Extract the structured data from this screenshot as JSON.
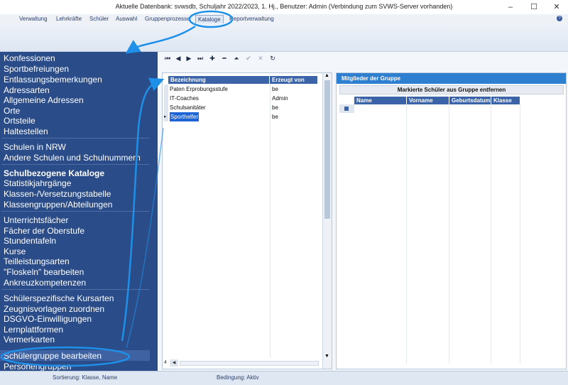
{
  "window": {
    "title": "Aktuelle Datenbank: svwsdb, Schuljahr 2022/2023, 1. Hj., Benutzer: Admin (Verbindung zum SVWS-Server vorhanden)",
    "minimize": "–",
    "maximize": "☐",
    "close": "✕"
  },
  "menu": {
    "items": [
      "Verwaltung",
      "Lehrkräfte",
      "Schüler",
      "Auswahl",
      "Gruppenprozesse",
      "Kataloge",
      "Reportverwaltung"
    ],
    "active": "Kataloge",
    "help": "?"
  },
  "sidebar": {
    "groups": [
      [
        "Konfessionen",
        "Sportbefreiungen",
        "Entlassungsbemerkungen",
        "Adressarten",
        "Allgemeine Adressen",
        "Orte",
        "Ortsteile",
        "Haltestellen"
      ],
      [
        "Schulen in NRW",
        "Andere Schulen und Schulnummern"
      ],
      [
        "Schulbezogene Kataloge",
        "Statistikjahrgänge",
        "Klassen-/Versetzungstabelle",
        "Klassengruppen/Abteilungen"
      ],
      [
        "Unterrichtsfächer",
        "Fächer der Oberstufe",
        "Stundentafeln",
        "Kurse",
        "Teilleistungsarten",
        "\"Floskeln\" bearbeiten",
        "Ankreuzkompetenzen"
      ],
      [
        "Schülerspezifische Kursarten",
        "Zeugnisvorlagen zuordnen",
        "DSGVO-Einwilligungen",
        "Lernplattformen",
        "Vermerkarten",
        "Schülergruppe bearbeiten",
        "Personengruppen"
      ]
    ],
    "selected": "Schülergruppe bearbeiten"
  },
  "toolbar": {
    "first": "⏮",
    "prev": "◀",
    "next": "▶",
    "last": "⏭",
    "add": "✚",
    "delete": "━",
    "up": "⏶",
    "save": "✔",
    "cancel": "✕",
    "refresh": "↻"
  },
  "groups_grid": {
    "columns": [
      "Bezeichnung",
      "Erzeugt von"
    ],
    "rows": [
      {
        "name": "Paten Erprobungsstufe",
        "creator": "be"
      },
      {
        "name": "IT-Coaches",
        "creator": "Admin"
      },
      {
        "name": "Schulsanitäter",
        "creator": "be"
      },
      {
        "name": "Sporthelfer",
        "creator": "be"
      }
    ],
    "row_count": "4",
    "row_marker": "▸",
    "scroll_left": "◀",
    "scroll_up": "▲",
    "scroll_down": "▼"
  },
  "members": {
    "header": "Mitglieder der Gruppe",
    "remove_button": "Markierte Schüler aus Gruppe entfernen",
    "columns": [
      "Name",
      "Vorname",
      "Geburtsdatum",
      "Klasse"
    ]
  },
  "status": {
    "sort": "Sortierung: Klasse, Name",
    "filter": "Bedingung: Aktiv"
  },
  "colors": {
    "sidebar": "#2a4c88",
    "grid_header": "#3a63a8",
    "panel_header": "#2e7fd0",
    "annotation": "#1e90e8"
  }
}
